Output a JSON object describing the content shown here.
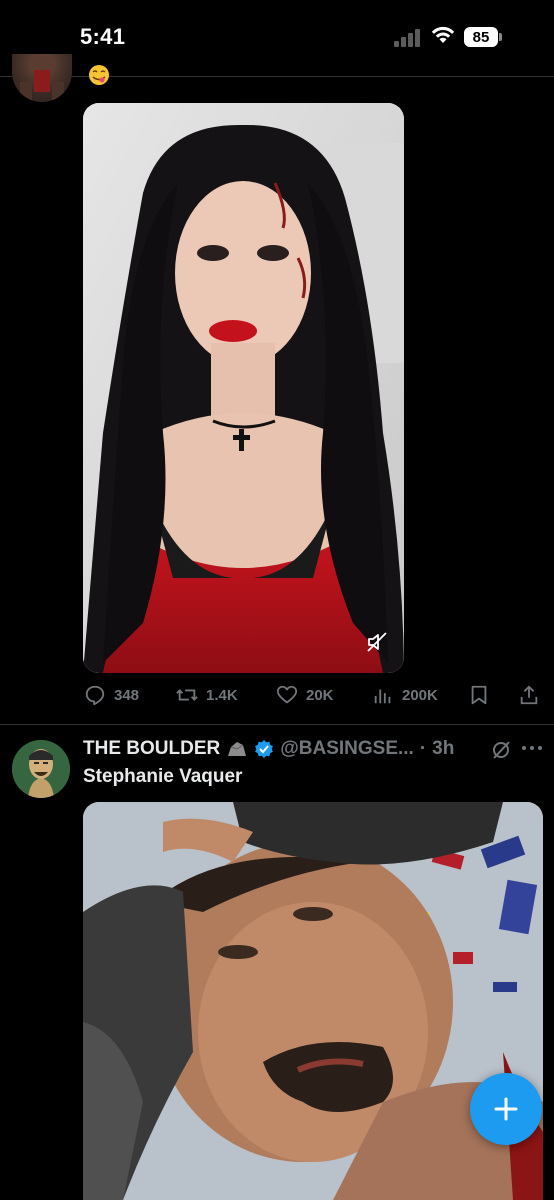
{
  "status_bar": {
    "time": "5:41",
    "battery": "85"
  },
  "previous_tweet": {
    "emoji_icon": "face-savoring-food-emoji"
  },
  "actions": {
    "replies": "348",
    "reposts": "1.4K",
    "likes": "20K",
    "views": "200K"
  },
  "tweet": {
    "display_name": "THE BOULDER",
    "handle": "@BASINGSE...",
    "separator": "·",
    "time": "3h",
    "text": "Stephanie Vaquer"
  },
  "colors": {
    "background": "#000000",
    "accent": "#1d9bf0",
    "muted": "#71767b",
    "divider": "#2f3336",
    "verified": "#1d9bf0"
  }
}
